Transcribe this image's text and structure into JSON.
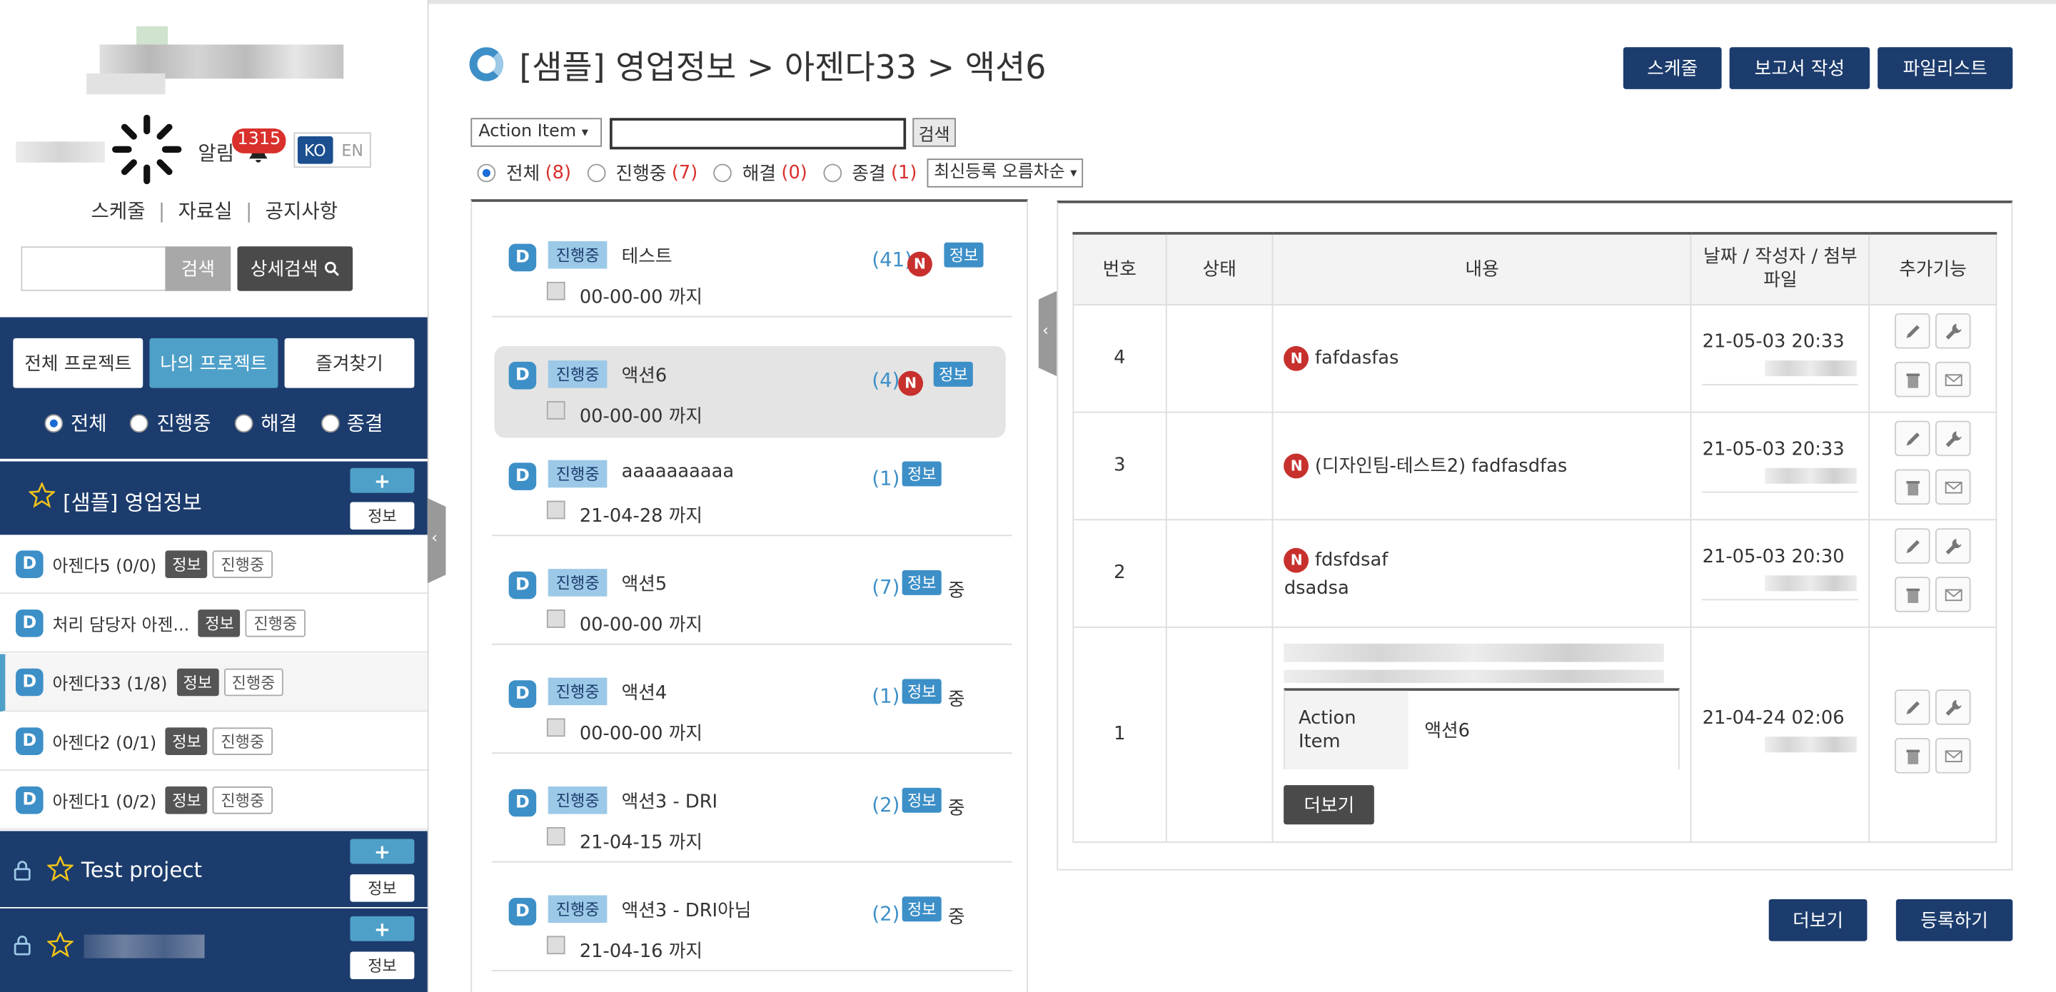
{
  "sidebar": {
    "alarm_label": "알림",
    "alarm_count": "1315",
    "lang": {
      "ko": "KO",
      "en": "EN"
    },
    "links": [
      "스케줄",
      "자료실",
      "공지사항"
    ],
    "search_btn": "검색",
    "adv_search_btn": "상세검색",
    "tabs": [
      "전체 프로젝트",
      "나의 프로젝트",
      "즐겨찾기"
    ],
    "filters": [
      "전체",
      "진행중",
      "해결",
      "종결"
    ],
    "project1": {
      "title": "[샘플] 영업정보",
      "plus": "+",
      "info": "정보"
    },
    "agendas": [
      {
        "name": "아젠다5 (0/0)",
        "info": "정보",
        "status": "진행중"
      },
      {
        "name": "처리 담당자 아젠...",
        "info": "정보",
        "status": "진행중"
      },
      {
        "name": "아젠다33 (1/8)",
        "info": "정보",
        "status": "진행중"
      },
      {
        "name": "아젠다2 (0/1)",
        "info": "정보",
        "status": "진행중"
      },
      {
        "name": "아젠다1 (0/2)",
        "info": "정보",
        "status": "진행중"
      }
    ],
    "project2": {
      "title": "Test project",
      "plus": "+",
      "info": "정보"
    },
    "project3": {
      "plus": "+",
      "info": "정보"
    },
    "d_letter": "D"
  },
  "header": {
    "title": "[샘플] 영업정보 > 아젠다33 > 액션6",
    "buttons": [
      "스케줄",
      "보고서 작성",
      "파일리스트"
    ]
  },
  "filter": {
    "select": "Action Item",
    "search_btn": "검색",
    "status": [
      {
        "label": "전체",
        "count": "(8)"
      },
      {
        "label": "진행중",
        "count": "(7)"
      },
      {
        "label": "해결",
        "count": "(0)"
      },
      {
        "label": "종결",
        "count": "(1)"
      }
    ],
    "sort": "최신등록 오름차순"
  },
  "list": [
    {
      "status": "진행중",
      "title": "테스트",
      "date": "00-00-00 까지",
      "count": "(41)",
      "n": "N",
      "info": "정보",
      "suffix": ""
    },
    {
      "status": "진행중",
      "title": "액션6",
      "date": "00-00-00 까지",
      "count": "(4)",
      "n": "N",
      "info": "정보",
      "suffix": ""
    },
    {
      "status": "진행중",
      "title": "aaaaaaaaaa",
      "date": "21-04-28 까지",
      "count": "(1)",
      "n": "",
      "info": "정보",
      "suffix": ""
    },
    {
      "status": "진행중",
      "title": "액션5",
      "date": "00-00-00 까지",
      "count": "(7)",
      "n": "",
      "info": "정보",
      "suffix": "중"
    },
    {
      "status": "진행중",
      "title": "액션4",
      "date": "00-00-00 까지",
      "count": "(1)",
      "n": "",
      "info": "정보",
      "suffix": "중"
    },
    {
      "status": "진행중",
      "title": "액션3 - DRI",
      "date": "21-04-15 까지",
      "count": "(2)",
      "n": "",
      "info": "정보",
      "suffix": "중"
    },
    {
      "status": "진행중",
      "title": "액션3 - DRI아님",
      "date": "21-04-16 까지",
      "count": "(2)",
      "n": "",
      "info": "정보",
      "suffix": "중"
    }
  ],
  "table": {
    "headers": [
      "번호",
      "상태",
      "내용",
      "날짜 / 작성자 / 첨부파일",
      "추가기능"
    ],
    "rows": [
      {
        "num": "4",
        "content": "fafdasfas",
        "date": "21-05-03 20:33"
      },
      {
        "num": "3",
        "content": "(디자인팀-테스트2) fadfasdfas",
        "date": "21-05-03 20:33"
      },
      {
        "num": "2",
        "content": "fdsfdsaf",
        "content2": "dsadsa",
        "date": "21-05-03 20:30"
      },
      {
        "num": "1",
        "inner_label": "Action Item",
        "inner_value": "액션6",
        "more": "더보기",
        "date": "21-04-24 02:06"
      }
    ],
    "n": "N"
  },
  "footer": {
    "more": "더보기",
    "register": "등록하기"
  }
}
